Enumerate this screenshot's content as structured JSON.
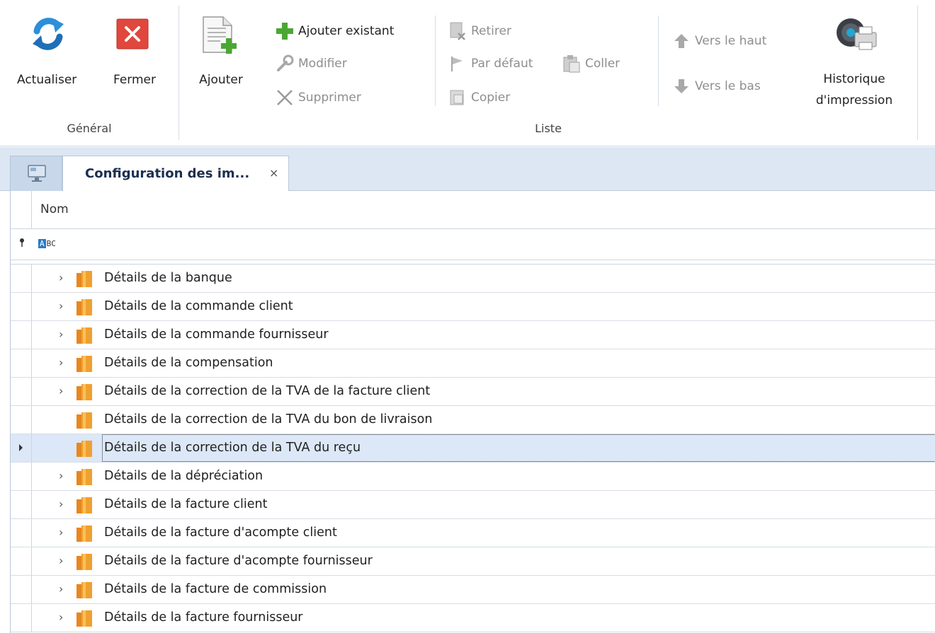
{
  "ribbon": {
    "groups": {
      "general": {
        "caption": "Général"
      },
      "liste": {
        "caption": "Liste"
      }
    },
    "buttons": {
      "actualiser": "Actualiser",
      "fermer": "Fermer",
      "ajouter": "Ajouter",
      "ajouter_existant": "Ajouter existant",
      "modifier": "Modifier",
      "supprimer": "Supprimer",
      "retirer": "Retirer",
      "par_defaut": "Par défaut",
      "copier": "Copier",
      "coller": "Coller",
      "vers_le_haut": "Vers le haut",
      "vers_le_bas": "Vers le bas",
      "historique_line1": "Historique",
      "historique_line2": "d'impression"
    }
  },
  "tabs": {
    "active_label": "Configuration des im...",
    "close_glyph": "×"
  },
  "grid": {
    "column_header": "Nom",
    "filter_pin": "⚲",
    "filter_abc_a": "A",
    "filter_abc_rest": "BC",
    "rows": [
      {
        "label": "Détails de la banque",
        "expandable": true,
        "selected": false
      },
      {
        "label": "Détails de la commande client",
        "expandable": true,
        "selected": false
      },
      {
        "label": "Détails de la commande fournisseur",
        "expandable": true,
        "selected": false
      },
      {
        "label": "Détails de la compensation",
        "expandable": true,
        "selected": false
      },
      {
        "label": "Détails de la correction de la TVA de la facture client",
        "expandable": true,
        "selected": false
      },
      {
        "label": "Détails de la correction de la TVA du bon de livraison",
        "expandable": false,
        "selected": false
      },
      {
        "label": "Détails de la correction de la TVA du reçu",
        "expandable": false,
        "selected": true
      },
      {
        "label": "Détails de la dépréciation",
        "expandable": true,
        "selected": false
      },
      {
        "label": "Détails de la facture client",
        "expandable": true,
        "selected": false
      },
      {
        "label": "Détails de la facture d'acompte client",
        "expandable": true,
        "selected": false
      },
      {
        "label": "Détails de la facture d'acompte fournisseur",
        "expandable": true,
        "selected": false
      },
      {
        "label": "Détails de la facture de commission",
        "expandable": true,
        "selected": false
      },
      {
        "label": "Détails de la facture fournisseur",
        "expandable": true,
        "selected": false
      }
    ]
  },
  "colors": {
    "accent": "#2d79c7",
    "selected_row": "#dce8f7",
    "tabstrip": "#dde7f3",
    "folder_orange": "#f0a030"
  }
}
